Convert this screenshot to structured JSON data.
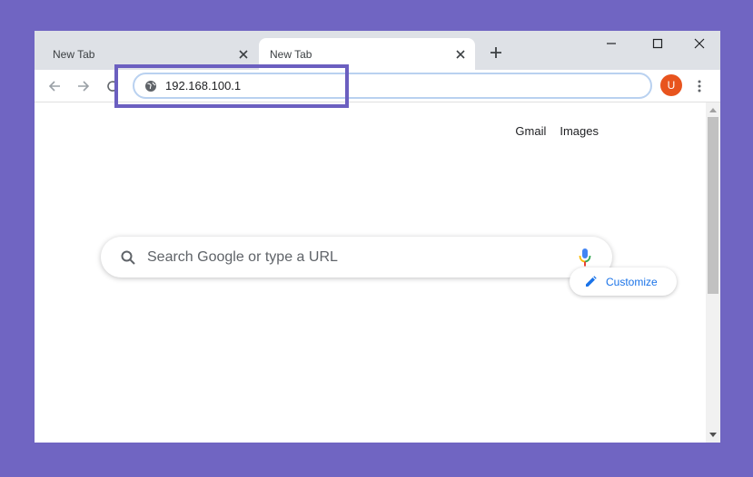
{
  "tabs": [
    {
      "title": "New Tab",
      "active": false
    },
    {
      "title": "New Tab",
      "active": true
    }
  ],
  "omnibox": {
    "url": "192.168.100.1"
  },
  "profile": {
    "initial": "U",
    "color": "#e8541e"
  },
  "page": {
    "top_links": [
      "Gmail",
      "Images"
    ],
    "search_placeholder": "Search Google or type a URL",
    "customize_label": "Customize"
  },
  "colors": {
    "background": "#7065c2",
    "highlight": "#6b5fc0",
    "accent": "#1a73e8"
  }
}
